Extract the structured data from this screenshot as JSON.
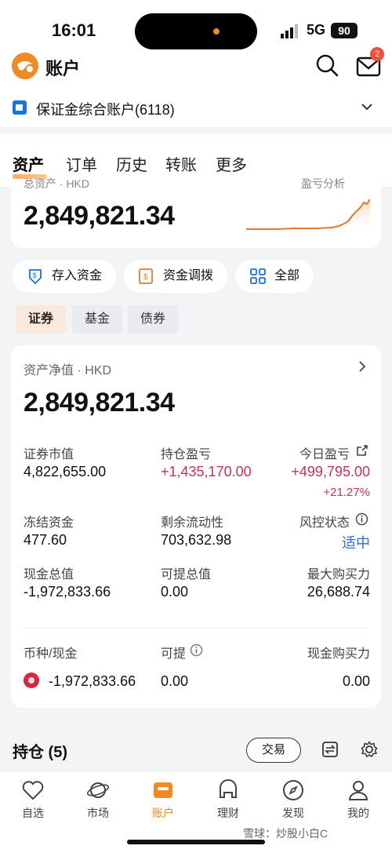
{
  "status": {
    "time": "16:01",
    "network": "5G",
    "battery": "90"
  },
  "header": {
    "title": "账户",
    "mail_badge": "2",
    "account": "保证金综合账户(6118)"
  },
  "tabs": [
    "资产",
    "订单",
    "历史",
    "转账",
    "更多"
  ],
  "summary": {
    "label": "总资产 · HKD",
    "link": "盈亏分析",
    "value": "2,849,821.34",
    "trend_color": "#e07a2c"
  },
  "actions": [
    "存入资金",
    "资金调拨",
    "全部"
  ],
  "segments": [
    "证券",
    "基金",
    "债券"
  ],
  "detail": {
    "net_label": "资产净值 · HKD",
    "net_value": "2,849,821.34",
    "rows": [
      [
        {
          "label": "证券市值",
          "value": "4,822,655.00"
        },
        {
          "label": "持仓盈亏",
          "value": "+1,435,170.00"
        },
        {
          "label": "今日盈亏",
          "value": "+499,795.00",
          "extra": "+21.27%"
        }
      ],
      [
        {
          "label": "冻结资金",
          "value": "477.60"
        },
        {
          "label": "剩余流动性",
          "value": "703,632.98"
        },
        {
          "label": "风控状态",
          "value": "适中"
        }
      ],
      [
        {
          "label": "现金总值",
          "value": "-1,972,833.66"
        },
        {
          "label": "可提总值",
          "value": "0.00"
        },
        {
          "label": "最大购买力",
          "value": "26,688.74"
        }
      ]
    ],
    "currency_header": [
      "币种/现金",
      "可提",
      "现金购买力"
    ],
    "currency_row": [
      "-1,972,833.66",
      "0.00",
      "0.00"
    ]
  },
  "holdings": {
    "title": "持仓 (5)",
    "trade": "交易"
  },
  "nav": [
    "自选",
    "市场",
    "账户",
    "理财",
    "发现",
    "我的"
  ],
  "watermark": "雪球：炒股小白C",
  "colors": {
    "accent": "#f08a24",
    "gain": "#c8305a",
    "link": "#2b6dd6"
  }
}
